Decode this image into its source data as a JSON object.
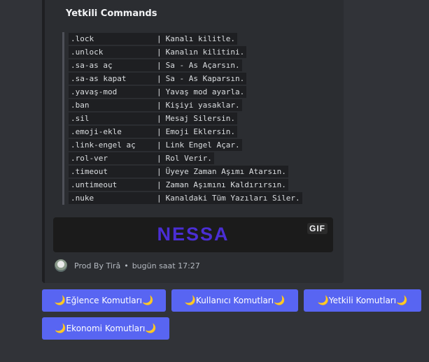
{
  "embed": {
    "title": "Yetkili Commands",
    "commands": [
      {
        "cmd": ".lock",
        "desc": "Kanalı kilitle."
      },
      {
        "cmd": ".unlock",
        "desc": "Kanalın kilitini."
      },
      {
        "cmd": ".sa-as aç",
        "desc": "Sa - As Açarsın."
      },
      {
        "cmd": ".sa-as kapat",
        "desc": "Sa - As Kaparsın."
      },
      {
        "cmd": ".yavaş-mod",
        "desc": "Yavaş mod ayarla."
      },
      {
        "cmd": ".ban",
        "desc": "Kişiyi yasaklar."
      },
      {
        "cmd": ".sil",
        "desc": "Mesaj Silersin."
      },
      {
        "cmd": ".emoji-ekle",
        "desc": "Emoji Eklersin."
      },
      {
        "cmd": ".link-engel aç",
        "desc": "Link Engel Açar."
      },
      {
        "cmd": ".rol-ver",
        "desc": "Rol Verir."
      },
      {
        "cmd": ".timeout",
        "desc": "Üyeye Zaman Aşımı Atarsın."
      },
      {
        "cmd": ".untimeout",
        "desc": "Zaman Aşımını Kaldırırsın."
      },
      {
        "cmd": ".nuke",
        "desc": "Kanaldaki Tüm Yazıları Siler."
      }
    ],
    "separator": "|",
    "gif_text": "NESSA",
    "gif_badge": "GIF",
    "footer_text": "Prod By Tirâ",
    "footer_dot": "•",
    "footer_time": "bugün saat 17:27"
  },
  "buttons": [
    {
      "label": "Eğlence Komutları",
      "emoji": "🌙"
    },
    {
      "label": "Kullanıcı Komutları",
      "emoji": "🌙"
    },
    {
      "label": "Yetkili Komutları",
      "emoji": "🌙"
    },
    {
      "label": "Ekonomi Komutları",
      "emoji": "🌙"
    }
  ],
  "colors": {
    "background": "#313338",
    "embed_bg": "#2b2d31",
    "button": "#5865f2",
    "gif_text": "#4a2ed4"
  },
  "icons": [
    "crescent-moon-icon",
    "avatar"
  ]
}
